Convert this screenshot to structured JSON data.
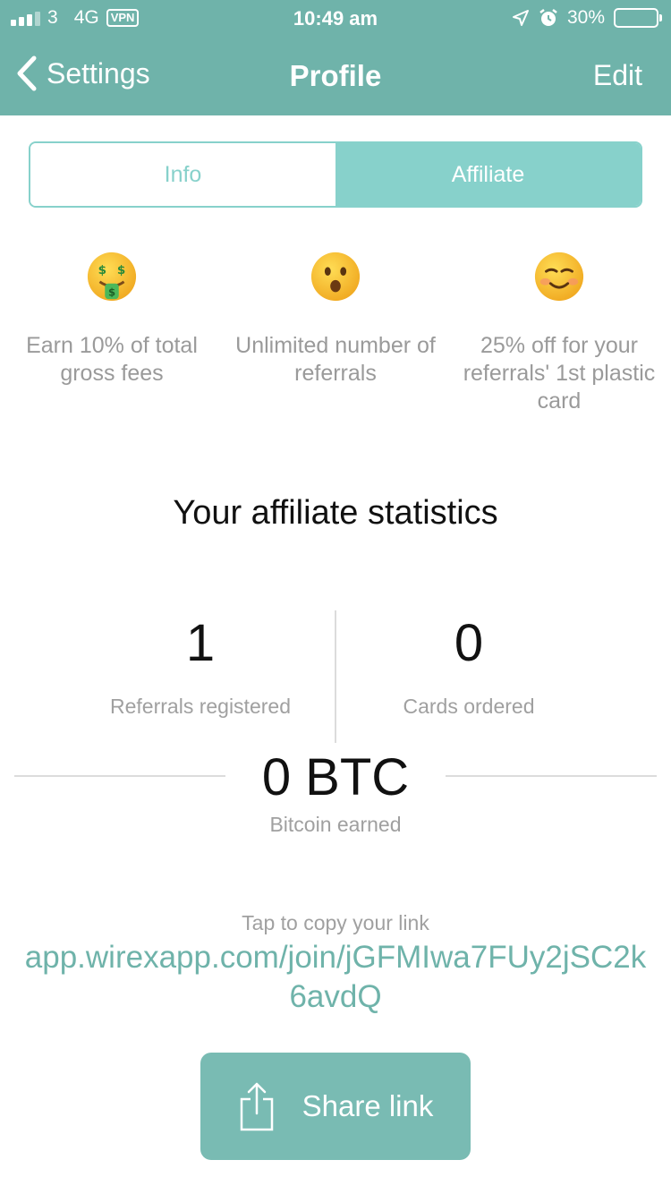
{
  "status_bar": {
    "carrier": "3",
    "network": "4G",
    "vpn": "VPN",
    "time": "10:49 am",
    "battery": "30%",
    "battery_level": 0.3
  },
  "nav": {
    "back_label": "Settings",
    "title": "Profile",
    "edit_label": "Edit"
  },
  "tabs": [
    {
      "label": "Info",
      "active": false
    },
    {
      "label": "Affiliate",
      "active": true
    }
  ],
  "benefits": [
    {
      "icon": "money-mouth-face-icon",
      "text": "Earn 10% of total gross fees"
    },
    {
      "icon": "surprised-face-icon",
      "text": "Unlimited number of referrals"
    },
    {
      "icon": "smiling-face-icon",
      "text": "25% off for your referrals' 1st plastic card"
    }
  ],
  "stats": {
    "title": "Your affiliate statistics",
    "referrals": {
      "value": "1",
      "label": "Referrals registered"
    },
    "cards": {
      "value": "0",
      "label": "Cards ordered"
    },
    "bitcoin": {
      "value": "0 BTC",
      "label": "Bitcoin earned"
    }
  },
  "link": {
    "hint": "Tap to copy your link",
    "url": "app.wirexapp.com/join/jGFMIwa7FUy2jSC2k6avdQ"
  },
  "share": {
    "label": "Share link",
    "icon": "share-icon"
  },
  "colors": {
    "header": "#6fb3aa",
    "accent": "#87d1cb",
    "button": "#79bbb3",
    "link": "#6fb3aa"
  }
}
